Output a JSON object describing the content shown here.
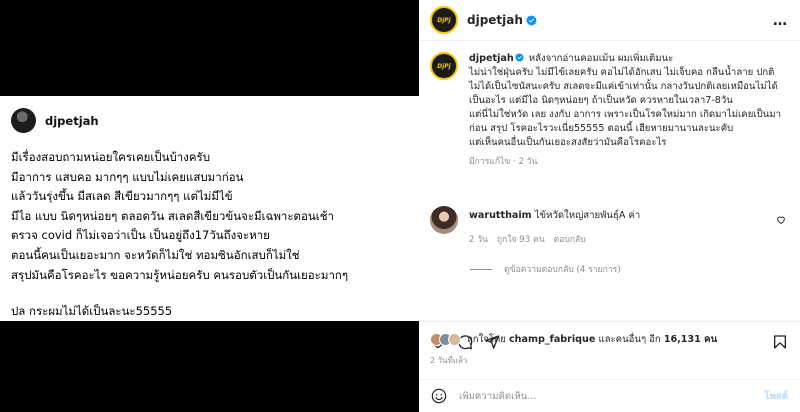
{
  "media_card": {
    "author": "djpetjah",
    "lines": [
      "มีเรื่องสอบถามหน่อยใครเคยเป็นบ้างครับ",
      "มีอาการ แสบคอ มากๆๆ แบบไม่เคยแสบมาก่อน",
      "แล้ววันรุ่งขึ้น มีสเลด สีเขียวมากๆๆ แต่ไม่มีไข้",
      "มีไอ แบบ นิดๆหน่อยๆ ตลอดวัน  สเลดสีเขียวข้นจะมีเฉพาะตอนเช้า",
      "ตรวจ covid ก็ไม่เจอว่าเป็น  เป็นอยู่ถึง17วันถึงจะหาย",
      "ตอนนี้คนเป็นเยอะมาก  จะหวัดก็ไม่ใช่ ทอมซินอักเสบก็ไม่ใช่",
      "สรุปมันคือโรคอะไร ขอความรู้หน่อยครับ คนรอบตัวเป็นกันเยอะมากๆ"
    ],
    "signature": "ปล  กระผมไม่ได้เป็นละนะ55555"
  },
  "header": {
    "username": "djpetjah",
    "avatar_text": "DjPj",
    "more_icon": "…"
  },
  "caption": {
    "username": "djpetjah",
    "lines": [
      "หลังจากอ่านคอมเม้น ผมเพิ่มเติมนะ",
      "ไม่น่าใช่ฝุ่นครับ ไม่มีไข้เลยครับ คอไม่ได้อักเสบ ไม่เจ็บคอ กลืนน้ำลาย ปกติ",
      "ไม่ได้เป็นไซนัสนะครับ สเลดจะมีแค่เข้าเท่านั้น กลางวันปกติเลยเหมือนไม่ได้เป็นอะไร แต่มีไอ นิดๆหน่อยๆ ถ้าเป็นหวัด ควรหายในเวลา7-8วัน",
      "แต่นี่ไม่ใช่หวัด เลย งงกับ อาการ เพราะเป็นโรคใหม่มาก เกิดมาไม่เคยเป็นมาก่อน สรุป โรคอะไรวะเนี่ย55555 ตอนนี้ เฮียหายมานานละนะคับ",
      "แต่เห็นคนอื่นเป็นกันเยอะสงสัยว่ามันคือโรคอะไร"
    ],
    "edited": "มีการแก้ไข",
    "time": "2 วัน"
  },
  "comment": {
    "username": "warutthaim",
    "text": "ไข้หวัดใหญ่สายพันธุ์A ค่า",
    "time": "2 วัน",
    "likes": "ถูกใจ 93 คน",
    "reply": "ตอบกลับ",
    "view_replies": "ดูข้อความตอบกลับ (4 รายการ)"
  },
  "likes": {
    "prefix": "ถูกใจโดย",
    "user": "champ_fabrique",
    "middle": "และคนอื่นๆ อีก",
    "count": "16,131 คน"
  },
  "posted": "2 วันที่แล้ว",
  "add_comment": {
    "placeholder": "เพิ่มความคิดเห็น...",
    "post_label": "โพสต์"
  },
  "colors": {
    "verified": "#0095f6",
    "link_disabled": "#b3dbff",
    "muted": "#8e8e8e"
  }
}
